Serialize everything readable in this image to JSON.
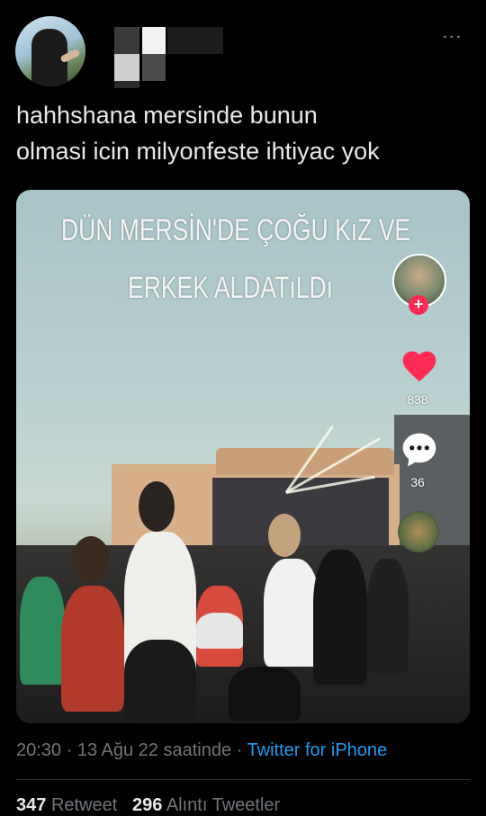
{
  "tweet": {
    "text_line1": "hahhshana mersinde bunun",
    "text_line2": "olmasi icin milyonfeste ihtiyac yok",
    "more_icon": "⋮"
  },
  "video": {
    "overlay_line1": "DÜN MERSİN'DE ÇOĞU KıZ VE",
    "overlay_line2": "ERKEK ALDATıLDı",
    "follow_plus": "+",
    "likes": "838",
    "comments": "36"
  },
  "meta": {
    "time": "20:30",
    "sep1": " · ",
    "date": "13 Ağu 22 saatinde",
    "sep2": " · ",
    "source": "Twitter for iPhone"
  },
  "stats": {
    "retweets_count": "347",
    "retweets_label": "Retweet",
    "quotes_count": "296",
    "quotes_label": "Alıntı Tweetler"
  },
  "colors": {
    "background": "#000000",
    "text": "#e7e9ea",
    "muted": "#71767b",
    "link": "#1d9bf0",
    "like": "#fe2c55"
  }
}
